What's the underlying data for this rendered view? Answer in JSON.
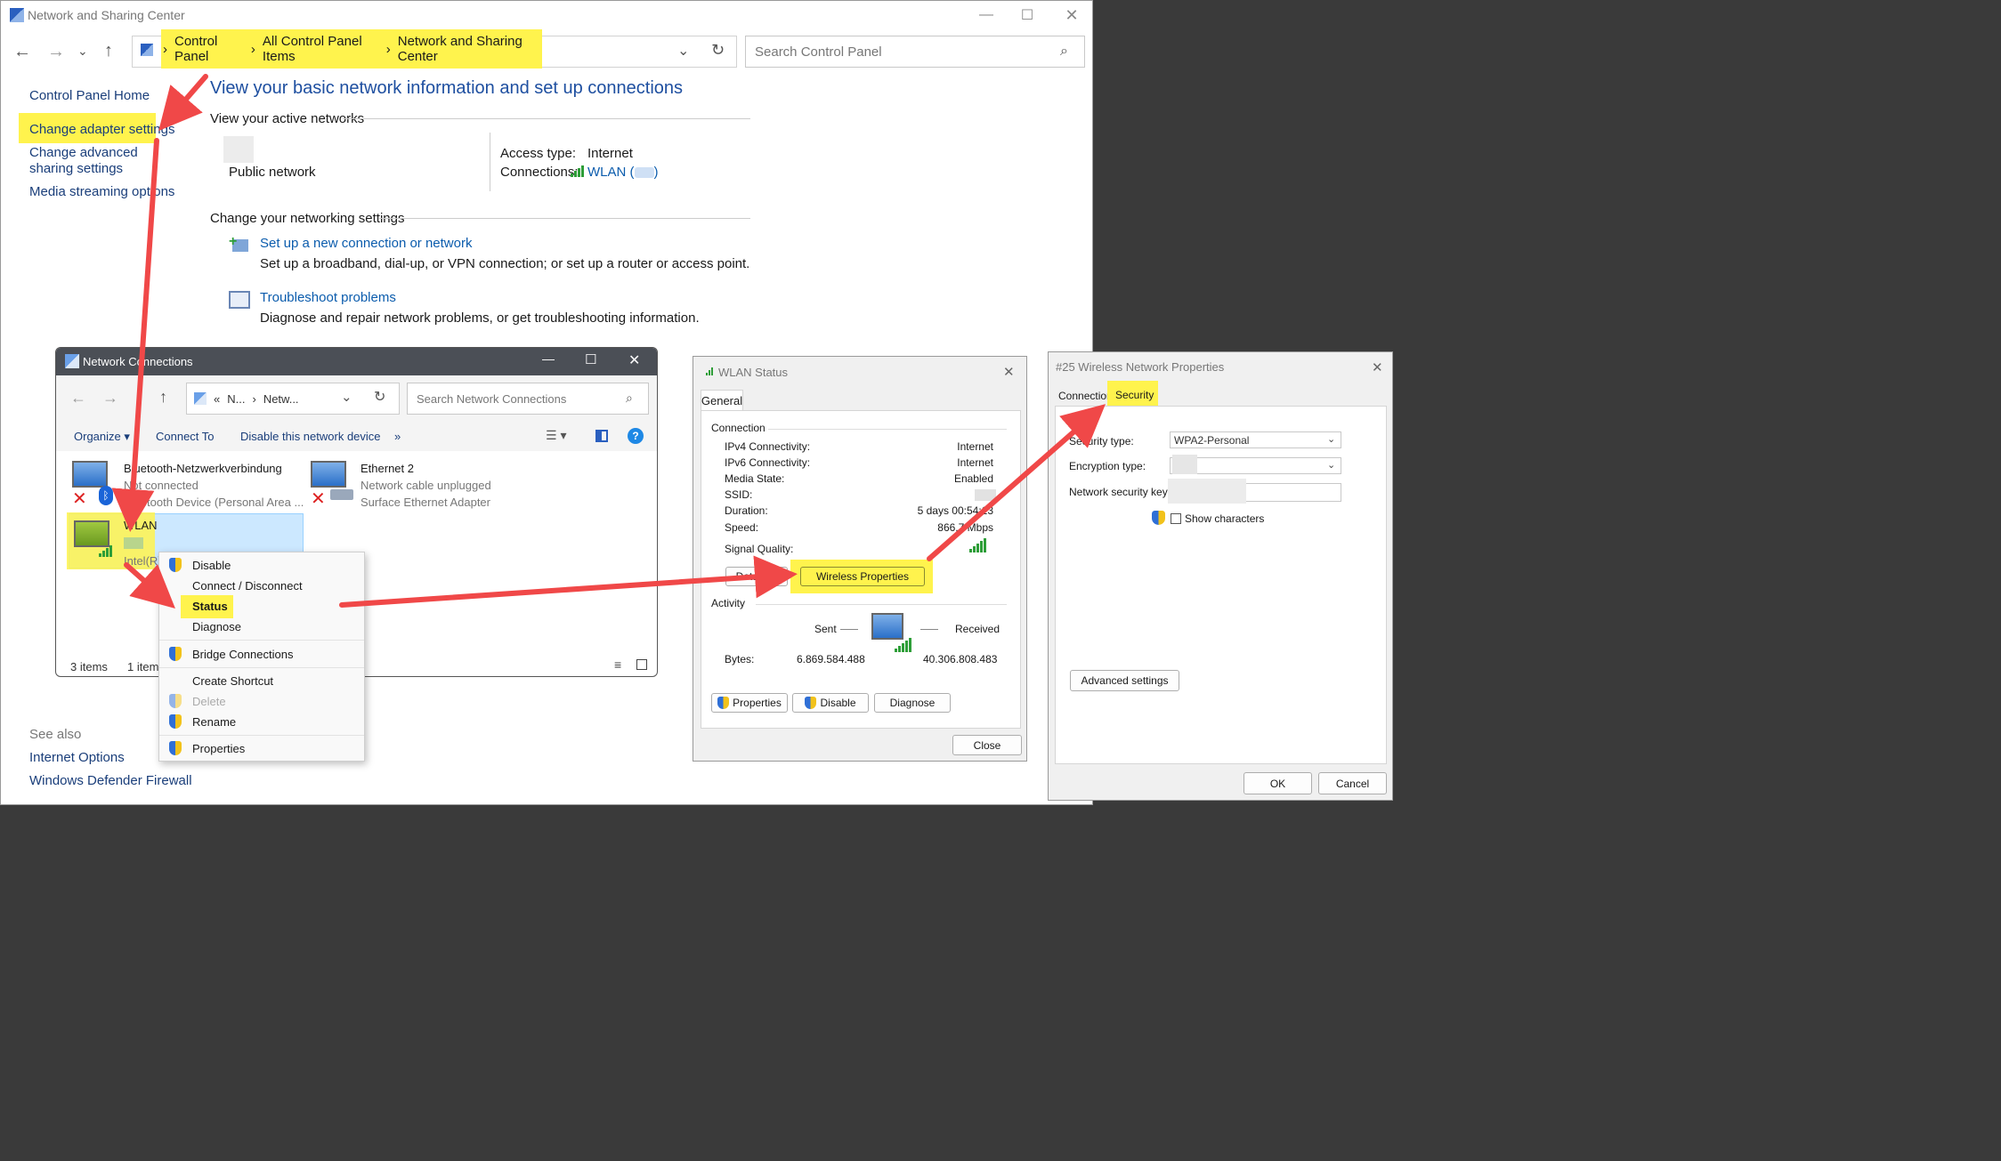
{
  "main": {
    "title": "Network and Sharing Center",
    "breadcrumb": [
      "Control Panel",
      "All Control Panel Items",
      "Network and Sharing Center"
    ],
    "search_placeholder": "Search Control Panel",
    "sidebar": {
      "home": "Control Panel Home",
      "adapter": "Change adapter settings",
      "advanced": "Change advanced sharing settings",
      "media": "Media streaming options",
      "see_also": "See also",
      "internet_options": "Internet Options",
      "firewall": "Windows Defender Firewall"
    },
    "heading": "View your basic network information and set up connections",
    "active_networks": "View your active networks",
    "network_type": "Public network",
    "access_type_label": "Access type:",
    "access_type_value": "Internet",
    "connections_label": "Connections:",
    "connection_link": "WLAN (",
    "connection_link_end": ")",
    "change_settings": "Change your networking settings",
    "setup_link": "Set up a new connection or network",
    "setup_desc": "Set up a broadband, dial-up, or VPN connection; or set up a router or access point.",
    "troubleshoot_link": "Troubleshoot problems",
    "troubleshoot_desc": "Diagnose and repair network problems, or get troubleshooting information."
  },
  "netconn": {
    "title": "Network Connections",
    "path_short1": "N...",
    "path_short2": "Netw...",
    "path_prefix": "«",
    "search_placeholder": "Search Network Connections",
    "toolbar": {
      "organize": "Organize",
      "connect": "Connect To",
      "disable": "Disable this network device",
      "more": "»"
    },
    "items": [
      {
        "name": "Bluetooth-Netzwerkverbindung",
        "status": "Not connected",
        "device": "Bluetooth Device (Personal Area ..."
      },
      {
        "name": "Ethernet 2",
        "status": "Network cable unplugged",
        "device": "Surface Ethernet Adapter"
      },
      {
        "name": "WLAN",
        "status": "",
        "device": "Intel(R)"
      }
    ],
    "status_count": "3 items",
    "status_selected": "1 item"
  },
  "context_menu": [
    "Disable",
    "Connect / Disconnect",
    "Status",
    "Diagnose",
    "Bridge Connections",
    "Create Shortcut",
    "Delete",
    "Rename",
    "Properties"
  ],
  "wlan_status": {
    "title": "WLAN Status",
    "tab": "General",
    "connection_group": "Connection",
    "rows": [
      {
        "label": "IPv4 Connectivity:",
        "value": "Internet"
      },
      {
        "label": "IPv6 Connectivity:",
        "value": "Internet"
      },
      {
        "label": "Media State:",
        "value": "Enabled"
      },
      {
        "label": "SSID:",
        "value": ""
      },
      {
        "label": "Duration:",
        "value": "5 days 00:54:13"
      },
      {
        "label": "Speed:",
        "value": "866.7 Mbps"
      }
    ],
    "signal_label": "Signal Quality:",
    "details_button": "Details...",
    "wireless_button": "Wireless Properties",
    "activity_group": "Activity",
    "sent": "Sent",
    "received": "Received",
    "bytes_label": "Bytes:",
    "bytes_sent": "6.869.584.488",
    "bytes_received": "40.306.808.483",
    "properties_button": "Properties",
    "disable_button": "Disable",
    "diagnose_button": "Diagnose",
    "close_button": "Close"
  },
  "wireless_props": {
    "title": "#25 Wireless Network Properties",
    "tab_connection": "Connection",
    "tab_security": "Security",
    "security_type_label": "Security type:",
    "security_type_value": "WPA2-Personal",
    "encryption_label": "Encryption type:",
    "key_label": "Network security key",
    "show_chars": "Show characters",
    "advanced_button": "Advanced settings",
    "ok_button": "OK",
    "cancel_button": "Cancel"
  },
  "colors": {
    "highlight": "#fff34d",
    "arrow": "#f04848",
    "link": "#0b5cad",
    "selection": "#cce8ff"
  }
}
